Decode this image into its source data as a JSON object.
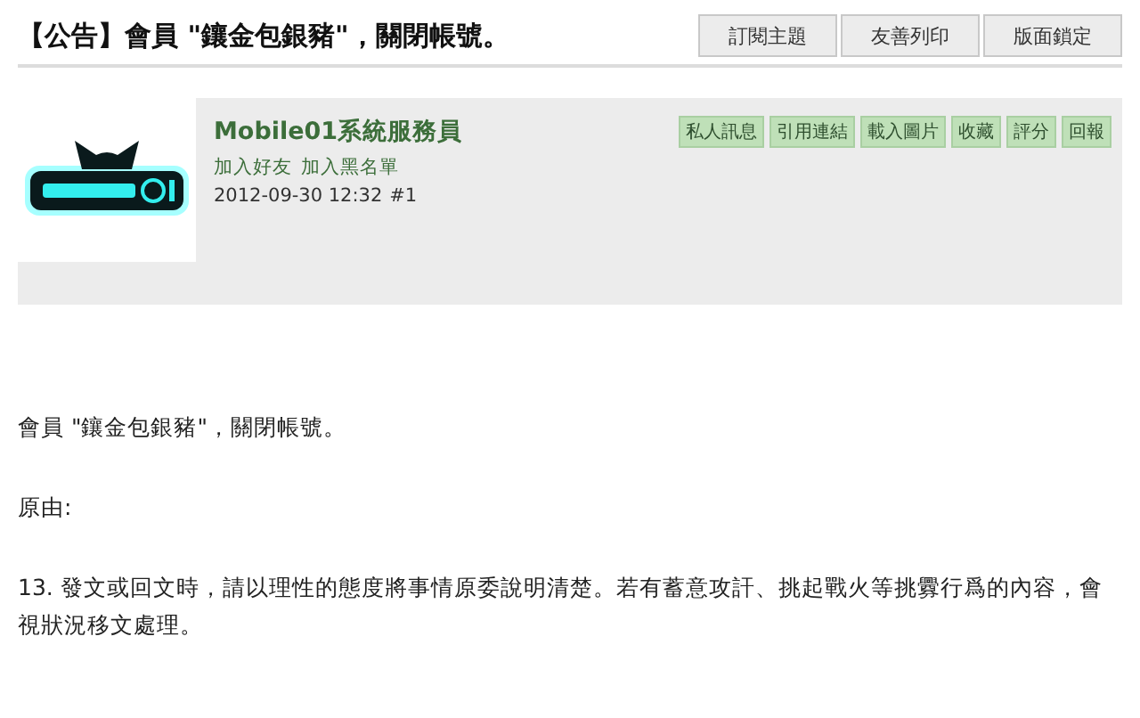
{
  "thread": {
    "title": "【公告】會員 \"鑲金包銀豬\"，關閉帳號。",
    "buttons": [
      "訂閱主題",
      "友善列印",
      "版面鎖定"
    ]
  },
  "post": {
    "author": "Mobile01系統服務員",
    "author_links": [
      "加入好友",
      "加入黑名單"
    ],
    "date": "2012-09-30 12:32",
    "number": "#1",
    "actions": [
      "私人訊息",
      "引用連結",
      "載入圖片",
      "收藏",
      "評分",
      "回報"
    ],
    "body": [
      "會員 \"鑲金包銀豬\"，關閉帳號。",
      "原由:",
      "13. 發文或回文時，請以理性的態度將事情原委說明清楚。若有蓄意攻訐、挑起戰火等挑釁行爲的內容，會視狀況移文處理。"
    ]
  }
}
